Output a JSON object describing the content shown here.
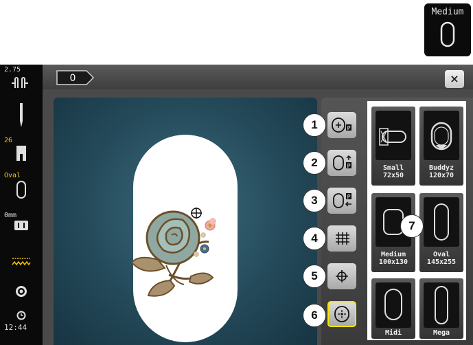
{
  "top_indicator": {
    "label": "Medium",
    "icon": "hoop-oval-icon"
  },
  "sidebar": {
    "stitch_width_value": "2.75",
    "needle_value": "26",
    "hoop_label": "Oval",
    "thread_value": "0mm",
    "time": "12:44"
  },
  "header": {
    "tab_label": "0",
    "close_label": "×"
  },
  "functions": [
    {
      "number": "1",
      "icon": "hoop-center-program-icon"
    },
    {
      "number": "2",
      "icon": "hoop-move-back-icon"
    },
    {
      "number": "3",
      "icon": "hoop-move-left-icon"
    },
    {
      "number": "4",
      "icon": "grid-icon"
    },
    {
      "number": "5",
      "icon": "crosshair-icon"
    },
    {
      "number": "6",
      "icon": "hoop-center-icon"
    }
  ],
  "hoop_grid_badge": "7",
  "hoops": [
    {
      "name": "Small",
      "size": "72x50"
    },
    {
      "name": "Buddyz",
      "size": "120x70"
    },
    {
      "name": "Medium",
      "size": "100x130"
    },
    {
      "name": "Oval",
      "size": "145x255"
    },
    {
      "name": "Midi",
      "size": ""
    },
    {
      "name": "Mega",
      "size": ""
    }
  ]
}
